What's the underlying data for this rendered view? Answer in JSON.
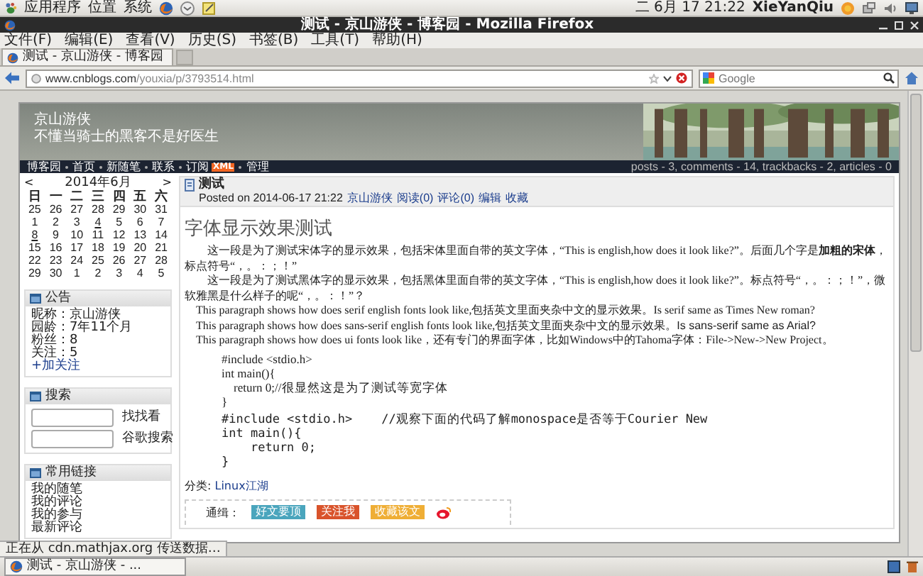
{
  "top_panel": {
    "menus": [
      "应用程序",
      "位置",
      "系统"
    ],
    "clock": "二 6月 17 21:22",
    "user": "XieYanQiu"
  },
  "window": {
    "title": "测试 - 京山游侠 - 博客园 - Mozilla Firefox"
  },
  "menu_bar": [
    "文件(F)",
    "编辑(E)",
    "查看(V)",
    "历史(S)",
    "书签(B)",
    "工具(T)",
    "帮助(H)"
  ],
  "tabs": [
    {
      "label": "测试 - 京山游侠 - 博客园",
      "selected": true
    }
  ],
  "address_bar": {
    "host": "www.cnblogs.com",
    "path": "/youxia/p/3793514.html"
  },
  "search": {
    "placeholder": "Google"
  },
  "blog": {
    "title": "京山游侠",
    "subtitle": "不懂当骑士的黑客不是好医生",
    "nav": [
      {
        "label": "博客园",
        "kind": "link"
      },
      {
        "label": "首页",
        "kind": "link"
      },
      {
        "label": "新随笔",
        "kind": "link"
      },
      {
        "label": "联系",
        "kind": "link"
      },
      {
        "label": "订阅",
        "kind": "link"
      },
      {
        "label": "XML",
        "kind": "badge"
      },
      {
        "label": "管理",
        "kind": "link"
      }
    ],
    "stats": "posts - 3, comments - 14, trackbacks - 2, articles - 0"
  },
  "calendar": {
    "prev": "<",
    "title": "2014年6月",
    "next": ">",
    "weekdays": [
      "日",
      "一",
      "二",
      "三",
      "四",
      "五",
      "六"
    ],
    "weeks": [
      [
        {
          "day": "25",
          "linked": false
        },
        {
          "day": "26",
          "linked": false
        },
        {
          "day": "27",
          "linked": false
        },
        {
          "day": "28",
          "linked": false
        },
        {
          "day": "29",
          "linked": false
        },
        {
          "day": "30",
          "linked": false
        },
        {
          "day": "31",
          "linked": false
        }
      ],
      [
        {
          "day": "1",
          "linked": false
        },
        {
          "day": "2",
          "linked": false
        },
        {
          "day": "3",
          "linked": false
        },
        {
          "day": "4",
          "linked": true
        },
        {
          "day": "5",
          "linked": false
        },
        {
          "day": "6",
          "linked": false
        },
        {
          "day": "7",
          "linked": false
        }
      ],
      [
        {
          "day": "8",
          "linked": true
        },
        {
          "day": "9",
          "linked": false
        },
        {
          "day": "10",
          "linked": false
        },
        {
          "day": "11",
          "linked": false
        },
        {
          "day": "12",
          "linked": false
        },
        {
          "day": "13",
          "linked": false
        },
        {
          "day": "14",
          "linked": false
        }
      ],
      [
        {
          "day": "15",
          "linked": false
        },
        {
          "day": "16",
          "linked": false
        },
        {
          "day": "17",
          "linked": false
        },
        {
          "day": "18",
          "linked": false
        },
        {
          "day": "19",
          "linked": false
        },
        {
          "day": "20",
          "linked": false
        },
        {
          "day": "21",
          "linked": false
        }
      ],
      [
        {
          "day": "22",
          "linked": false
        },
        {
          "day": "23",
          "linked": false
        },
        {
          "day": "24",
          "linked": false
        },
        {
          "day": "25",
          "linked": false
        },
        {
          "day": "26",
          "linked": false
        },
        {
          "day": "27",
          "linked": false
        },
        {
          "day": "28",
          "linked": false
        }
      ],
      [
        {
          "day": "29",
          "linked": false
        },
        {
          "day": "30",
          "linked": false
        },
        {
          "day": "1",
          "linked": false
        },
        {
          "day": "2",
          "linked": false
        },
        {
          "day": "3",
          "linked": false
        },
        {
          "day": "4",
          "linked": false
        },
        {
          "day": "5",
          "linked": false
        }
      ]
    ]
  },
  "notice_box": {
    "title": "公告",
    "lines": [
      {
        "text": "昵称：京山游侠",
        "kind": "text"
      },
      {
        "text": "园龄：7年11个月",
        "kind": "text"
      },
      {
        "text": "粉丝：8",
        "kind": "text"
      },
      {
        "text": "关注：5",
        "kind": "text"
      },
      {
        "text": "+加关注",
        "kind": "link"
      }
    ]
  },
  "search_box": {
    "title": "搜索",
    "rows": [
      {
        "button": "找找看"
      },
      {
        "button": "谷歌搜索"
      }
    ]
  },
  "links_box": {
    "title": "常用链接",
    "items": [
      "我的随笔",
      "我的评论",
      "我的参与",
      "最新评论"
    ]
  },
  "post": {
    "title": "测试",
    "posted": "Posted on 2014-06-17 21:22",
    "author": "京山游侠",
    "actions": [
      "阅读(0)",
      "评论(0)",
      "编辑",
      "收藏"
    ],
    "heading": "字体显示效果测试",
    "paragraphs": [
      {
        "indent": true,
        "segments": [
          {
            "kind": "song",
            "text": "这一段是为了测试宋体字的显示效果，包括宋体里面自带的英文字体，“This is english,how does it look like?”。后面几个字是**加粗的宋体**，标点符号“，。：；！”"
          }
        ]
      },
      {
        "indent": true,
        "segments": [
          {
            "kind": "song",
            "text": "这一段是为了测试黑体字的显示效果，包括黑体里面自带的英文字体，“This is english,how does it look like?”。标点符号“，。：；！”，微软雅黑是什么样子的呢“，。：！”？"
          }
        ]
      },
      {
        "indent": false,
        "segments": [
          {
            "kind": "song",
            "text": "This paragraph shows how does serif english fonts look like,包括英文里面夹杂中文的显示效果。"
          },
          {
            "kind": "serif",
            "text": "Is serif same as Times New roman?"
          }
        ]
      },
      {
        "indent": false,
        "segments": [
          {
            "kind": "song",
            "text": "This paragraph shows how does sans-serif english fonts look like,包括英文里面夹杂中文的显示效果。"
          },
          {
            "kind": "sans",
            "text": "Is sans-serif same as Arial?"
          }
        ]
      },
      {
        "indent": false,
        "segments": [
          {
            "kind": "song",
            "text": "This paragraph shows how does ui fonts look like，还有专门的界面字体，比如Windows中的Tahoma字体：File->New->New Project。"
          }
        ]
      }
    ],
    "code_blocks": [
      {
        "kind": "song",
        "lines": [
          "#include <stdio.h>",
          "int main(){",
          "    return 0;//很显然这是为了测试等宽字体",
          "}"
        ]
      },
      {
        "kind": "mono",
        "lines": [
          "#include <stdio.h>    //观察下面的代码了解monospace是否等于Courier New",
          "int main(){",
          "    return 0;",
          "}"
        ]
      }
    ],
    "category_label": "分类:",
    "category": "Linux江湖",
    "share_label": "通缉：",
    "share_buttons": [
      {
        "label": "好文要顶",
        "color": "#4aa5bd"
      },
      {
        "label": "关注我",
        "color": "#d9532b"
      },
      {
        "label": "收藏该文",
        "color": "#efae35"
      }
    ]
  },
  "status": "正在从 cdn.mathjax.org 传送数据…",
  "taskbar": [
    {
      "label": "测试 - 京山游侠 - ...",
      "selected": true
    }
  ]
}
